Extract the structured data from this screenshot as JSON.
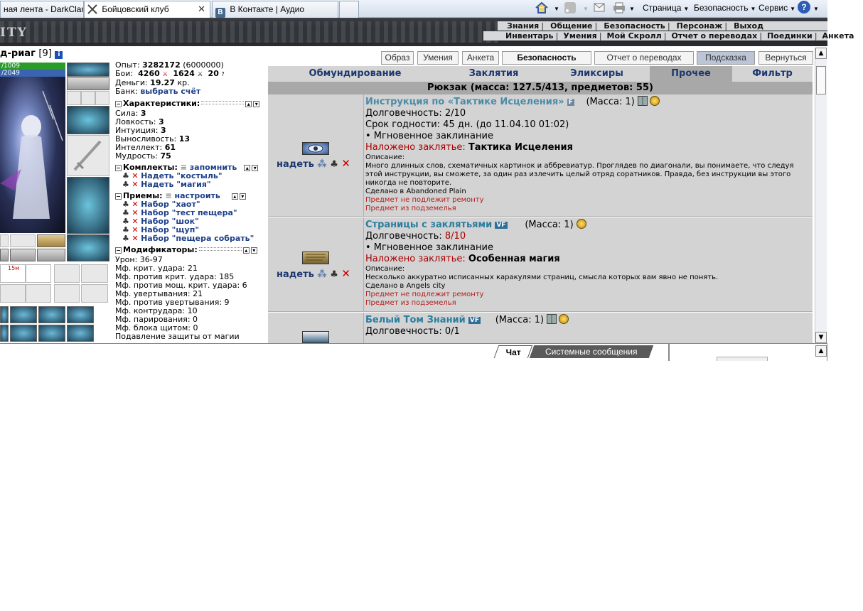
{
  "browser": {
    "tabs": [
      {
        "label": "ная лента - DarkClan"
      },
      {
        "label": "Бойцовский клуб"
      },
      {
        "label": "В Контакте | Аудио"
      }
    ],
    "vk_icon_letter": "B",
    "close_glyph": "✕",
    "commands": [
      "Страница",
      "Безопасность",
      "Сервис"
    ],
    "help_glyph": "?"
  },
  "game": {
    "logo_text": "ITY",
    "top_nav_row1": [
      "Знания",
      "Общение",
      "Безопасность",
      "Персонаж",
      "Выход"
    ],
    "top_nav_row2": [
      "Инвентарь",
      "Умения",
      "Мой Скролл",
      "Отчет о переводах",
      "Поединки",
      "Анкета"
    ]
  },
  "character": {
    "name": "д-риаг",
    "level": "[9]",
    "info_glyph": "i",
    "hp": "/1009",
    "mp": "/2049",
    "slot_badge": "15м"
  },
  "stats": {
    "exp_label": "Опыт:",
    "exp_value": "3282172",
    "exp_next": "(6000000)",
    "battles_label": "Бои:",
    "wins": "4260",
    "losses": "1624",
    "draws": "20",
    "money_label": "Деньги:",
    "money_value": "19.27",
    "money_unit": "кр.",
    "bank_label": "Банк:",
    "bank_link": "выбрать счёт",
    "chars_head": "Характеристики:",
    "attributes": [
      {
        "label": "Сила:",
        "value": "3"
      },
      {
        "label": "Ловкость:",
        "value": "3"
      },
      {
        "label": "Интуиция:",
        "value": "3"
      },
      {
        "label": "Выносливость:",
        "value": "13"
      },
      {
        "label": "Интеллект:",
        "value": "61"
      },
      {
        "label": "Мудрость:",
        "value": "75"
      }
    ],
    "sets_head": "Комплекты:",
    "sets_link": "запомнить",
    "sets": [
      "Надеть \"костыль\"",
      "Надеть \"магия\""
    ],
    "tricks_head": "Приемы:",
    "tricks_link": "настроить",
    "tricks": [
      "Набор \"хаот\"",
      "Набор \"тест пещера\"",
      "Набор \"шок\"",
      "Набор \"щуп\"",
      "Набор \"пещера собрать\""
    ],
    "mods_head": "Модификаторы:",
    "modifiers": [
      "Урон: 36-97",
      "Мф. крит. удара: 21",
      "Мф. против крит. удара: 185",
      "Мф. против мощ. крит. удара: 6",
      "Мф. увертывания: 21",
      "Мф. против увертывания: 9",
      "Мф. контрудара: 10",
      "Мф. парирования: 0",
      "Мф. блока щитом: 0",
      "Подавление защиты от магии"
    ]
  },
  "top_buttons": [
    "Образ",
    "Умения",
    "Анкета",
    "Безопасность",
    "Отчет о переводах",
    "Подсказка",
    "Вернуться"
  ],
  "categories": [
    "Обмундирование",
    "Заклятия",
    "Эликсиры",
    "Прочее",
    "Фильтр"
  ],
  "backpack_header": "Рюкзак (масса: 127.5/413, предметов: 55)",
  "item_action": "надеть",
  "items": [
    {
      "title": "Инструкция по «Тактике Исцеления»",
      "badge": "F",
      "mass": "(Масса: 1)",
      "durability_label": "Долговечность:",
      "durability_value": "2/10",
      "expiry": "Срок годности: 45 дн. (до 11.04.10 01:02)",
      "instant": "• Мгновенное заклинание",
      "spell_label": "Наложено заклятье:",
      "spell_name": "Тактика Исцеления",
      "desc_label": "Описание:",
      "desc": "Много длинных слов, схематичных картинок и аббревиатур. Проглядев по диагонали, вы понимаете, что следуя этой инструкции, вы сможете, за один раз излечить целый отряд соратников. Правда, без инструкции вы этого никогда не повторите.",
      "made_in": "Сделано в Abandoned Plain",
      "no_repair": "Предмет не подлежит ремонту",
      "from_dungeon": "Предмет из подземелья"
    },
    {
      "title": "Страницы с заклятьями",
      "badge": "VF",
      "mass": "(Масса: 1)",
      "durability_label": "Долговечность:",
      "durability_value": "8/10",
      "instant": "• Мгновенное заклинание",
      "spell_label": "Наложено заклятье:",
      "spell_name": "Особенная магия",
      "desc_label": "Описание:",
      "desc": "Несколько аккуратно исписанных каракулями страниц, смысла которых вам явно не понять.",
      "made_in": "Сделано в Angels city",
      "no_repair": "Предмет не подлежит ремонту",
      "from_dungeon": "Предмет из подземелья"
    },
    {
      "title": "Белый Том Знаний",
      "badge": "VF",
      "mass": "(Масса: 1)",
      "durability_label": "Долговечность:",
      "durability_value": "0/1"
    }
  ],
  "chat": {
    "tab_chat": "Чат",
    "tab_system": "Системные сообщения"
  },
  "colors": {
    "accent": "#1d3870",
    "hp": "#2a9b2a",
    "mp": "#3a63b0",
    "item_title": "#2b7d9e",
    "warning": "#b41e1e"
  }
}
